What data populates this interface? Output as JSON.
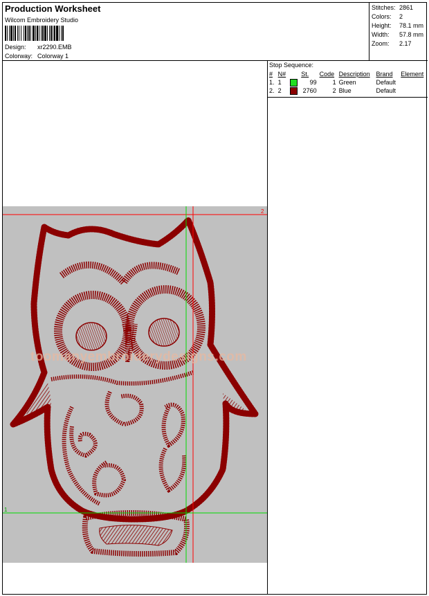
{
  "header": {
    "title": "Production Worksheet",
    "company": "Wilcom  Embroidery Studio",
    "design_label": "Design:",
    "design_value": "xr2290.EMB",
    "colorway_label": "Colorway:",
    "colorway_value": "Colorway 1"
  },
  "stats": {
    "stitches_label": "Stitches:",
    "stitches_value": "2861",
    "colors_label": "Colors:",
    "colors_value": "2",
    "height_label": "Height:",
    "height_value": "78.1 mm",
    "width_label": "Width:",
    "width_value": "57.8 mm",
    "zoom_label": "Zoom:",
    "zoom_value": "2.17"
  },
  "stop_sequence": {
    "title": "Stop Sequence:",
    "columns": [
      "#",
      "N#",
      "St.",
      "Code",
      "Description",
      "Brand",
      "Element"
    ],
    "rows": [
      {
        "num": "1.",
        "n": "1",
        "color": "#22dd22",
        "stitches": "99",
        "code": "1",
        "description": "Green",
        "brand": "Default",
        "element": ""
      },
      {
        "num": "2.",
        "n": "2",
        "color": "#8b0000",
        "stitches": "2760",
        "code": "2",
        "description": "Blue",
        "brand": "Default",
        "element": ""
      }
    ]
  },
  "design_preview": {
    "marker_top": "2",
    "marker_bottom": "1",
    "watermark": "toomanyembroiderydesigns.com",
    "stitch_color": "#8b0000",
    "guide_colors": {
      "green": "#00dd00",
      "red": "#ff0000"
    }
  }
}
